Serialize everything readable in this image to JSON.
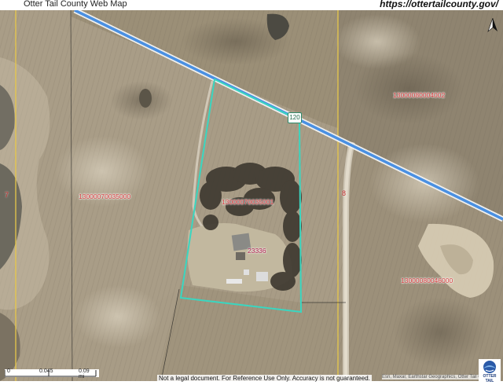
{
  "header": {
    "title": "Otter Tail County Web Map",
    "url": "https://ottertailcounty.gov/"
  },
  "map": {
    "parcels": [
      {
        "id": "13000080004002"
      },
      {
        "id": "13000070035000"
      },
      {
        "id": "13000070035001"
      },
      {
        "id": "13000080046000"
      }
    ],
    "section_numbers": [
      "7",
      "8"
    ],
    "address": "23336",
    "route": "120",
    "colors": {
      "road": "#4a90e2",
      "parcel_outline": "#3ad6c0",
      "section_line": "#e8c84a",
      "parcel_label": "#d23a3a"
    }
  },
  "scale": {
    "labels": [
      "0",
      "0.045",
      "0.09 mi"
    ]
  },
  "footer": {
    "disclaimer": "Not a legal document. For Reference Use Only. Accuracy is not guaranteed.",
    "credits": "Esri, Maxar, Earthstar Geographics, Otter Tail County",
    "logo_text": "OTTER TAIL"
  },
  "icons": [
    "north-arrow-icon",
    "otter-tail-logo"
  ]
}
